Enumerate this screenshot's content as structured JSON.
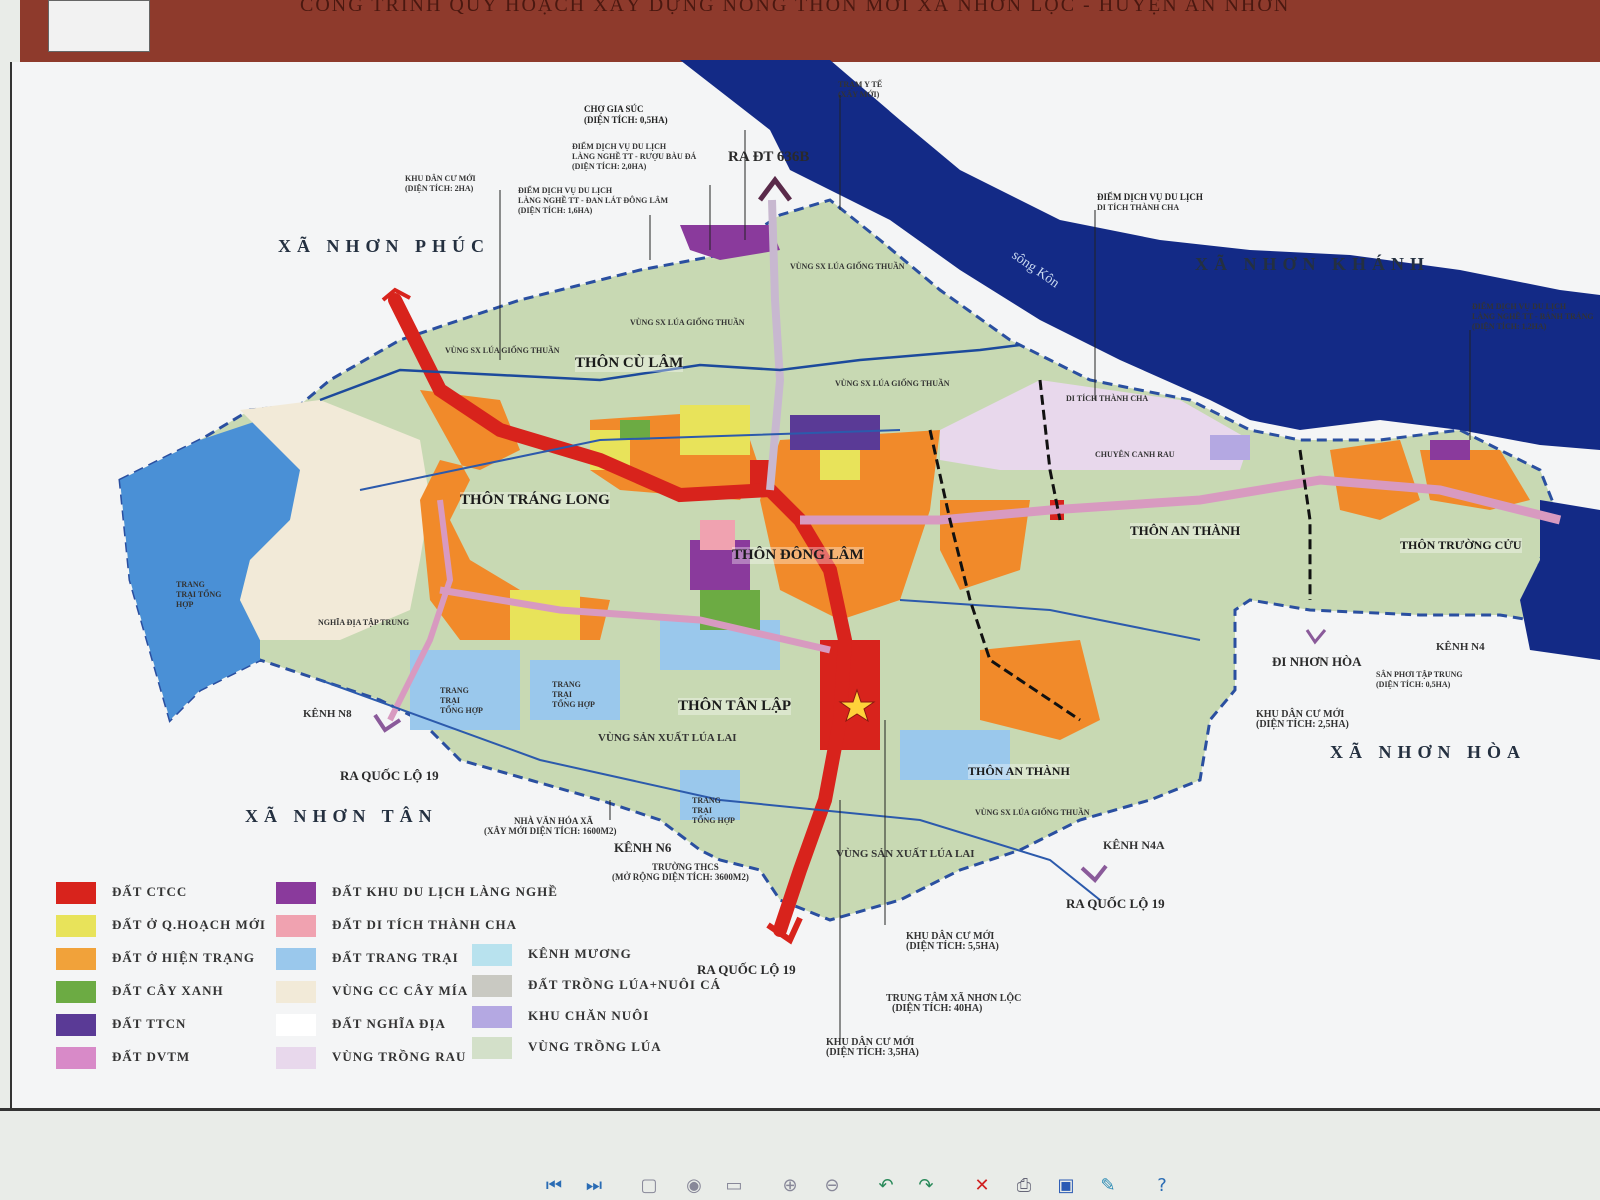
{
  "header": {
    "title": "CÔNG TRÌNH QUY HOẠCH XÂY DỰNG NÔNG THÔN MỚI XÃ NHƠN LỘC - HUYỆN AN NHƠN"
  },
  "colors": {
    "header_bar": "#8e3a2c",
    "river": "#132a86",
    "base_green": "#c8d9b3",
    "ctcc": "#d8231c",
    "qhoach_moi": "#e8e35a",
    "hien_trang": "#f18a2a",
    "cay_xanh": "#6cab43",
    "ttcn": "#5a3a96",
    "dvtm": "#d88ac8",
    "du_lich": "#8a3a9c",
    "di_tich": "#f0a2b0",
    "trang_trai": "#9ac8ec",
    "cay_mia": "#f2ead8",
    "nghia_dia": "#ffffff",
    "trong_rau": "#e8d8ec",
    "kenh_muong": "#b8e2ee",
    "lua_ca": "#c9c9c2",
    "chan_nuoi": "#b4a8e2",
    "trong_lua": "#d3e0c9"
  },
  "communes": {
    "nhon_phuc": "XÃ NHƠN PHÚC",
    "nhon_khanh": "XÃ NHƠN KHÁNH",
    "nhon_tan": "XÃ NHƠN TÂN",
    "nhon_hoa": "XÃ NHƠN HÒA"
  },
  "hamlets": {
    "cu_lam": "THÔN CÙ LÂM",
    "trang_long": "THÔN TRÁNG LONG",
    "dong_lam": "THÔN ĐÔNG LÂM",
    "an_thanh_1": "THÔN AN THÀNH",
    "truong_cuu": "THÔN TRƯỜNG CỬU",
    "tan_lap": "THÔN TÂN LẬP",
    "an_thanh_2": "THÔN AN THÀNH"
  },
  "roads": {
    "dt636b": "RA ĐT 636B",
    "ql19_a": "RA QUỐC LỘ 19",
    "ql19_b": "RA QUỐC LỘ 19",
    "ql19_c": "RA QUỐC LỘ 19",
    "nhon_hoa": "ĐI NHƠN HÒA"
  },
  "river_label": "sông Kôn",
  "canals": {
    "n8": "KÊNH N8",
    "n6": "KÊNH N6",
    "n4": "KÊNH N4",
    "n4a": "KÊNH N4A"
  },
  "annotations": {
    "cho_gia_suc": "CHỢ GIA SÚC",
    "cho_gia_suc_area": "(DIỆN TÍCH: 0,5HA)",
    "dich_vu_ruou": "ĐIỂM DỊCH VỤ DU LỊCH",
    "dich_vu_ruou_sub": "LÀNG NGHỀ TT - RƯỢU BÀU ĐÁ",
    "dich_vu_ruou_area": "(DIỆN TÍCH: 2,0HA)",
    "dich_vu_dan_lat": "ĐIỂM DỊCH VỤ DU LỊCH",
    "dich_vu_dan_lat_sub": "LÀNG NGHỀ TT - ĐAN LÁT ĐÔNG LÂM",
    "dich_vu_dan_lat_area": "(DIỆN TÍCH: 1,6HA)",
    "khu_dan_cu_moi_top": "KHU DÂN CƯ MỚI",
    "khu_dan_cu_moi_top_area": "(DIỆN TÍCH: 2HA)",
    "tram_y_te": "TRẠM Y TẾ",
    "tram_y_te_sub": "(XÂY MỚI)",
    "di_tich_dv": "ĐIỂM DỊCH VỤ DU LỊCH",
    "di_tich_dv_sub": "DI TÍCH THÀNH CHA",
    "dv_banh_trang": "ĐIỂM DỊCH VỤ DU LỊCH",
    "dv_banh_trang_sub": "LÀNG NGHỀ TT - BÁNH TRÁNG",
    "dv_banh_trang_area": "(DIỆN TÍCH: 1,2HA)",
    "vung_giong_1": "VÙNG SX LÚA GIỐNG THUẦN",
    "vung_giong_2": "VÙNG SX LÚA GIỐNG THUẦN",
    "vung_giong_3": "VÙNG SX LÚA GIỐNG THUẦN",
    "vung_giong_4": "VÙNG SX LÚA GIỐNG THUẦN",
    "vung_giong_5": "VÙNG SX LÚA GIỐNG THUẦN",
    "di_tich_thanh_cha": "DI TÍCH THÀNH CHA",
    "chuyen_canh": "CHUYÊN CANH RAU",
    "trang_trai_1": "TRANG TRẠI TỔNG HỢP",
    "trang_trai_2": "TRANG TRẠI TỔNG HỢP",
    "trang_trai_3": "TRANG TRẠI TỔNG HỢP",
    "trang_trai_4": "TRANG TRẠI TỔNG HỢP",
    "nghia_dia": "NGHĨA ĐỊA TẬP TRUNG",
    "vung_lua_lai_1": "VÙNG SẢN XUẤT LÚA LAI",
    "vung_lua_lai_2": "VÙNG SẢN XUẤT LÚA LAI",
    "khu_dc_moi_right": "KHU DÂN CƯ MỚI",
    "khu_dc_moi_right_area": "(DIỆN TÍCH: 2,5HA)",
    "san_phoi": "SÂN PHƠI TẬP TRUNG",
    "san_phoi_area": "(DIỆN TÍCH: 0,5HA)",
    "nha_van_hoa": "NHÀ VĂN HÓA XÃ",
    "nha_van_hoa_sub": "(XÂY MỚI DIỆN TÍCH: 1600M2)",
    "truong_thcs": "TRƯỜNG THCS",
    "truong_thcs_sub": "(MỞ RỘNG DIỆN TÍCH: 3600M2)",
    "khu_dc_moi_bottom": "KHU DÂN CƯ MỚI",
    "khu_dc_moi_bottom_area": "(DIỆN TÍCH: 5,5HA)",
    "trung_tam": "TRUNG TÂM XÃ NHƠN LỘC",
    "trung_tam_area": "(DIỆN TÍCH: 40HA)",
    "khu_dc_moi_b2": "KHU DÂN CƯ MỚI",
    "khu_dc_moi_b2_area": "(DIỆN TÍCH: 3,5HA)"
  },
  "legend": [
    {
      "label": "ĐẤT CTCC",
      "color": "#d8231c"
    },
    {
      "label": "ĐẤT Ở Q.HOẠCH MỚI",
      "color": "#e8e35a"
    },
    {
      "label": "ĐẤT Ở HIỆN TRẠNG",
      "color": "#f1a23a"
    },
    {
      "label": "ĐẤT CÂY XANH",
      "color": "#6cab43"
    },
    {
      "label": "ĐẤT TTCN",
      "color": "#5a3a96"
    },
    {
      "label": "ĐẤT DVTM",
      "color": "#d88ac8"
    },
    {
      "label": "ĐẤT KHU DU LỊCH LÀNG NGHỀ",
      "color": "#8a3a9c"
    },
    {
      "label": "ĐẤT DI TÍCH THÀNH CHA",
      "color": "#f0a2b0"
    },
    {
      "label": "ĐẤT TRANG TRẠI",
      "color": "#9ac8ec"
    },
    {
      "label": "VÙNG CC CÂY MÍA",
      "color": "#f2ead8"
    },
    {
      "label": "ĐẤT NGHĨA ĐỊA",
      "color": "#ffffff"
    },
    {
      "label": "VÙNG TRỒNG RAU",
      "color": "#e8d8ec"
    },
    {
      "label": "KÊNH MƯƠNG",
      "color": "#b8e2ee"
    },
    {
      "label": "ĐẤT TRỒNG LÚA+NUÔI CÁ",
      "color": "#c9c9c2"
    },
    {
      "label": "KHU CHĂN NUÔI",
      "color": "#b4a8e2"
    },
    {
      "label": "VÙNG TRỒNG LÚA",
      "color": "#d3e0c9"
    }
  ],
  "toolbar": [
    {
      "icon": "prev-icon",
      "glyph": "⏮",
      "color": "#2a6cb4"
    },
    {
      "icon": "next-icon",
      "glyph": "⏭",
      "color": "#2a6cb4"
    },
    {
      "icon": "fit-icon",
      "glyph": "▢",
      "color": "#889"
    },
    {
      "icon": "actual-size-icon",
      "glyph": "◉",
      "color": "#889"
    },
    {
      "icon": "slideshow-icon",
      "glyph": "▭",
      "color": "#889"
    },
    {
      "icon": "zoom-in-icon",
      "glyph": "⊕",
      "color": "#889"
    },
    {
      "icon": "zoom-out-icon",
      "glyph": "⊖",
      "color": "#889"
    },
    {
      "icon": "rotate-left-icon",
      "glyph": "↶",
      "color": "#2a8a5a"
    },
    {
      "icon": "rotate-right-icon",
      "glyph": "↷",
      "color": "#2a8a5a"
    },
    {
      "icon": "delete-icon",
      "glyph": "✕",
      "color": "#d02020"
    },
    {
      "icon": "print-icon",
      "glyph": "⎙",
      "color": "#667"
    },
    {
      "icon": "save-icon",
      "glyph": "▣",
      "color": "#2a5ab4"
    },
    {
      "icon": "edit-icon",
      "glyph": "✎",
      "color": "#2a8ab4"
    },
    {
      "icon": "help-icon",
      "glyph": "?",
      "color": "#2a6cb4"
    }
  ]
}
